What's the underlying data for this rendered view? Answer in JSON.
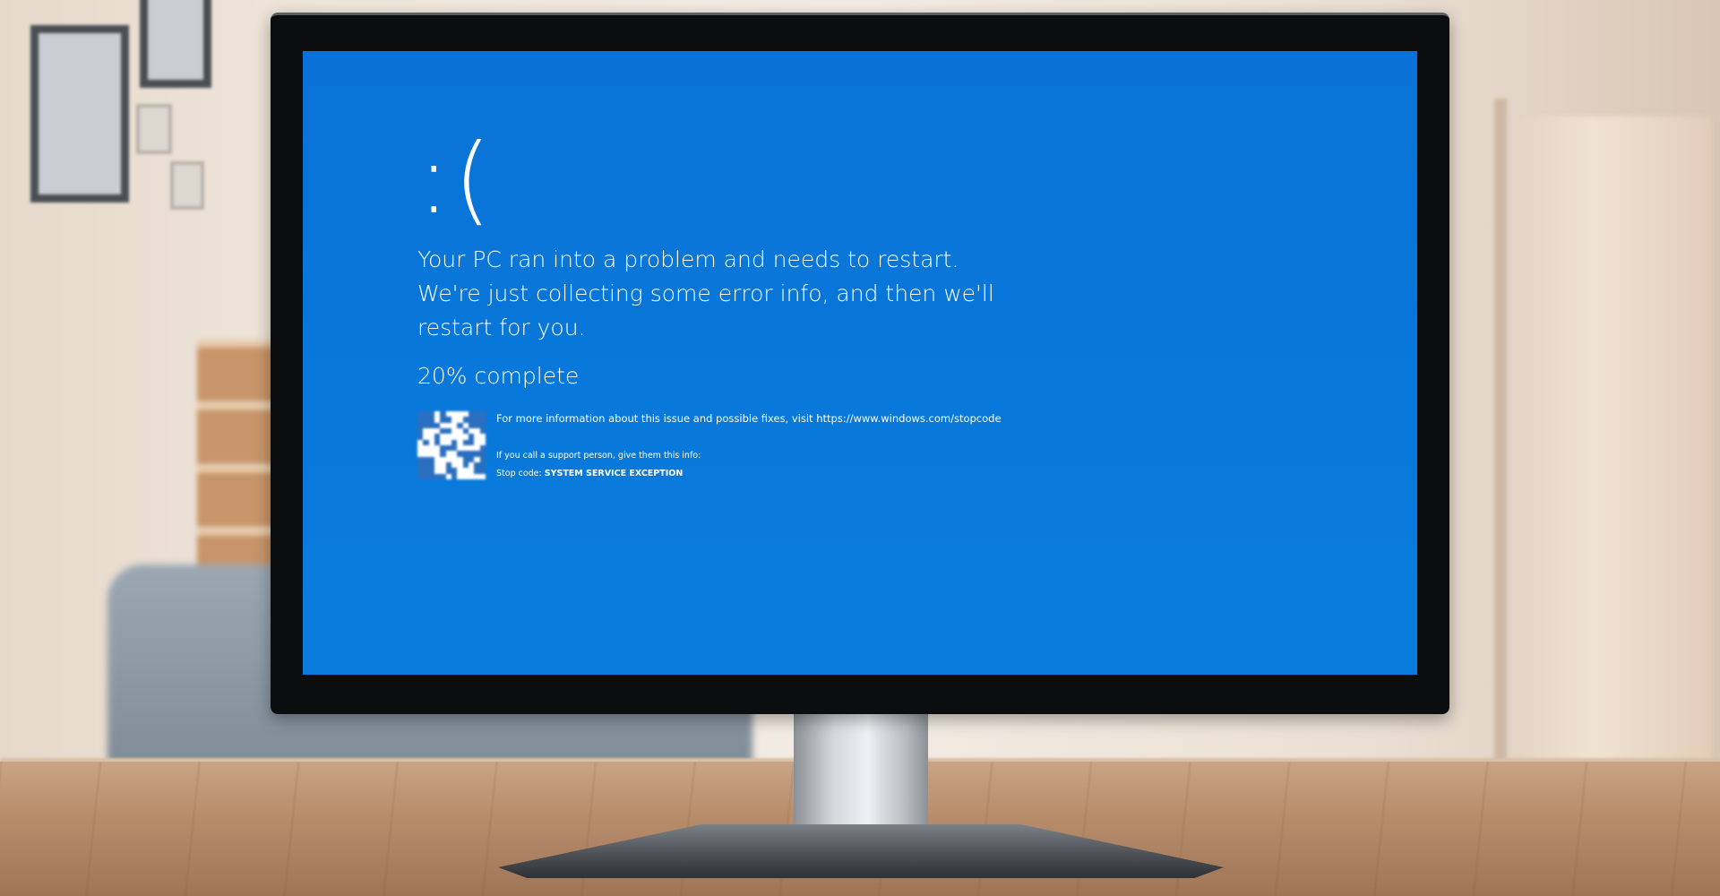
{
  "bsod": {
    "face": ":(",
    "message": "Your PC ran into a problem and needs to restart. We're just collecting some error info, and then we'll restart for you.",
    "progress_percent": 20,
    "progress_text": "20% complete",
    "more_info": "For more information about this issue and possible fixes, visit https://www.windows.com/stopcode",
    "support_prompt": "If you call a support person, give them this info:",
    "stop_code_label": "Stop code:",
    "stop_code_value": "SYSTEM SERVICE EXCEPTION"
  },
  "colors": {
    "screen_blue": "#0878da",
    "text": "#ffffff",
    "bezel": "#0c0d0e"
  }
}
